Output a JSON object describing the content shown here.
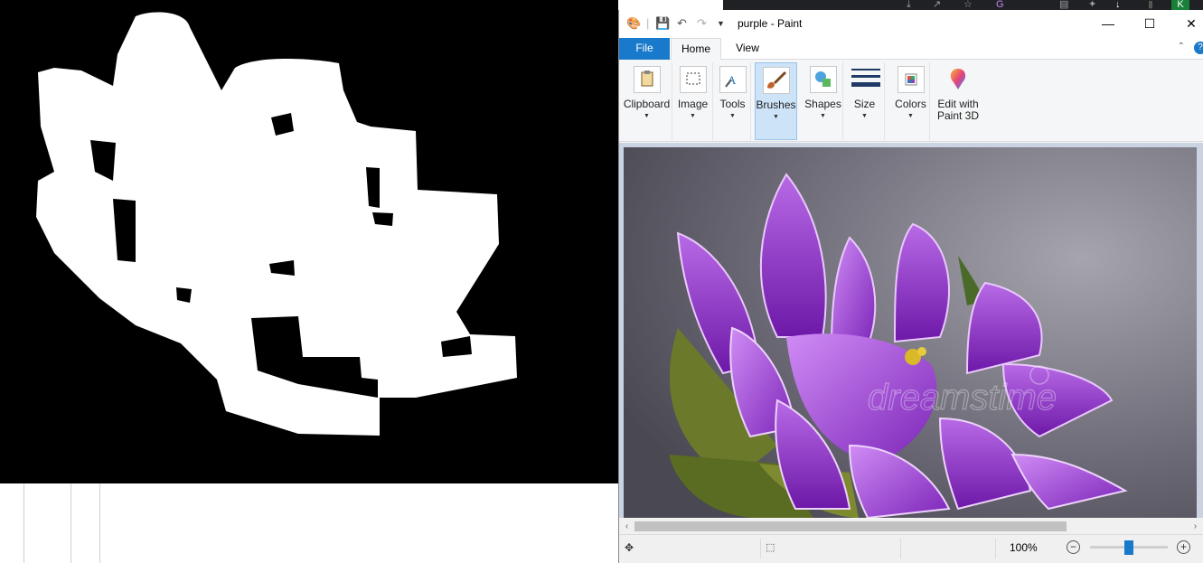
{
  "window": {
    "title": "purple - Paint",
    "quick_access": [
      "save-icon",
      "undo-icon",
      "redo-icon",
      "customize-dropdown-icon"
    ]
  },
  "tabs": [
    {
      "label": "File"
    },
    {
      "label": "Home"
    },
    {
      "label": "View"
    }
  ],
  "ribbon": {
    "groups": [
      {
        "label": "Clipboard",
        "icon": "clipboard-icon"
      },
      {
        "label": "Image",
        "icon": "select-icon"
      },
      {
        "label": "Tools",
        "icon": "tools-icon"
      },
      {
        "label": "Brushes",
        "icon": "brush-icon",
        "active": true
      },
      {
        "label": "Shapes",
        "icon": "shapes-icon"
      },
      {
        "label": "Size",
        "icon": "line-size-icon"
      },
      {
        "label": "Colors",
        "icon": "palette-icon"
      },
      {
        "label": "Edit with\nPaint 3D",
        "icon": "paint3d-icon"
      }
    ]
  },
  "canvas": {
    "watermark": "dreamstime"
  },
  "statusbar": {
    "zoom": "100%",
    "zoom_level": 0.5
  },
  "browser_avatar_letter": "K",
  "colors": {
    "accent": "#1979ca",
    "purple": "#8e2fc4",
    "leaf": "#6b7a2a"
  }
}
